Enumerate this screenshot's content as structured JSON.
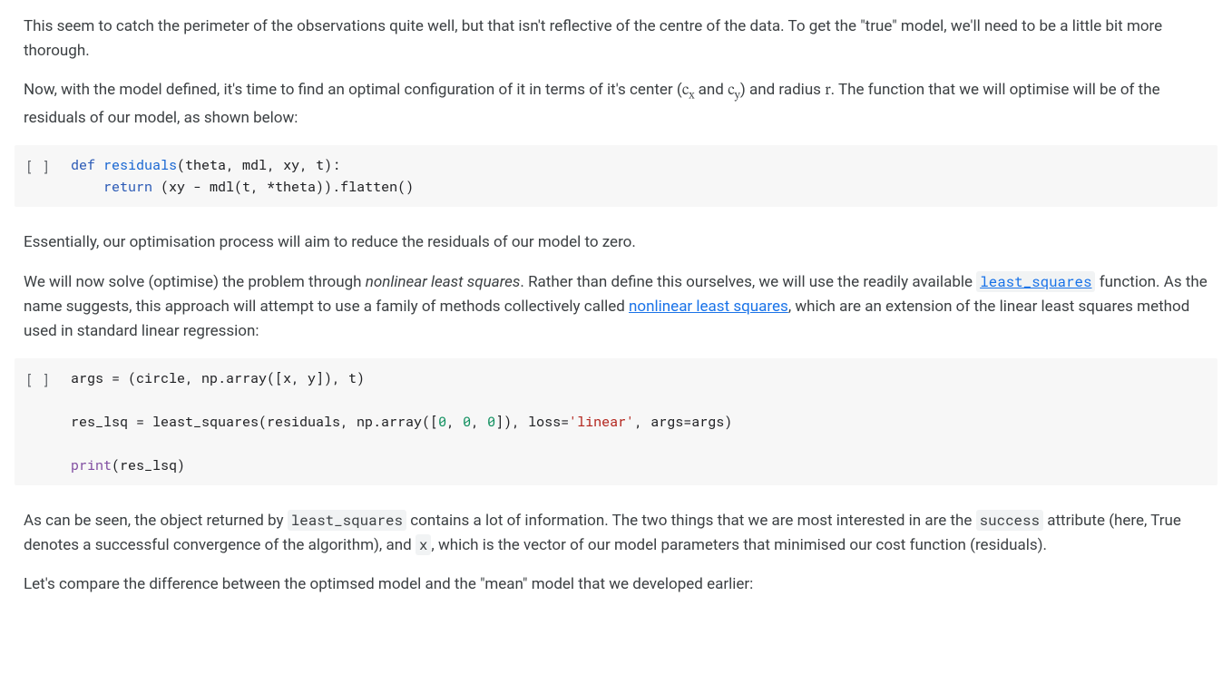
{
  "text": {
    "p1": "This seem to catch the perimeter of the observations quite well, but that isn't reflective of the centre of the data. To get the \"true\" model, we'll need to be a little bit more thorough.",
    "p2_a": "Now, with the model defined, it's time to find an optimal configuration of it in terms of it's center (",
    "p2_cx_c": "c",
    "p2_cx_sub": "x",
    "p2_and": " and ",
    "p2_cy_c": "c",
    "p2_cy_sub": "y",
    "p2_b": ") and radius ",
    "p2_r": "r",
    "p2_c": ". The function that we will optimise will be of the residuals of our model, as shown below:",
    "p3": "Essentially, our optimisation process will aim to reduce the residuals of our model to zero.",
    "p4_a": "We will now solve (optimise) the problem through ",
    "p4_em": "nonlinear least squares",
    "p4_b": ". Rather than define this ourselves, we will use the readily available ",
    "p4_link1_code": "least_squares",
    "p4_c": " function. As the name suggests, this approach will attempt to use a family of methods collectively called ",
    "p4_link2": "nonlinear least squares",
    "p4_d": ", which are an extension of the linear least squares method used in standard linear regression:",
    "p5_a": "As can be seen, the object returned by ",
    "p5_code1": "least_squares",
    "p5_b": " contains a lot of information. The two things that we are most interested in are the ",
    "p5_code2": "success",
    "p5_c": " attribute (here, True denotes a successful convergence of the algorithm), and ",
    "p5_code3": "x",
    "p5_d": ", which is the vector of our model parameters that minimised our cost function (residuals).",
    "p6": "Let's compare the difference between the optimsed model and the \"mean\" model that we developed earlier:"
  },
  "code1": {
    "gutter": "[ ]",
    "kw_def": "def",
    "name_residuals": "residuals",
    "sig_open": "(theta, mdl, xy, t):",
    "indent": "    ",
    "kw_return": "return",
    "body_rest": " (xy - mdl(t, *theta)).flatten()"
  },
  "code2": {
    "gutter": "[ ]",
    "l1_a": "args = (circle, np.array([x, y]), t)",
    "blank": "",
    "l3_a": "res_lsq = least_squares(residuals, np.array([",
    "l3_n0": "0",
    "l3_c": ", ",
    "l3_n1": "0",
    "l3_n2": "0",
    "l3_b": "]), loss=",
    "l3_str": "'linear'",
    "l3_d": ", args=args)",
    "l5_print": "print",
    "l5_rest": "(res_lsq)"
  }
}
